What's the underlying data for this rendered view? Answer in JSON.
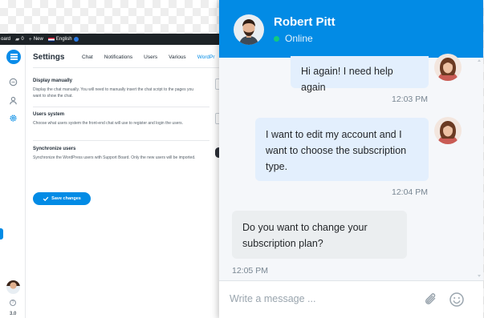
{
  "admin": {
    "wpbar": {
      "site_fragment": "oard",
      "comments_count": "0",
      "new_label": "New",
      "language_label": "English"
    },
    "rail_version": "3.0",
    "settings_title": "Settings",
    "tabs": [
      "Chat",
      "Notifications",
      "Users",
      "Various",
      "WordPr"
    ],
    "options": [
      {
        "title": "Display manually",
        "description": "Display the chat manually. You will need to manually insert the chat script to the pages you want to show the chat."
      },
      {
        "title": "Users system",
        "description": "Choose what users system the front-end chat will use to register and login the users."
      },
      {
        "title": "Synchronize users",
        "description": "Synchronize the WordPress users with Support Board. Only the new users will be imported."
      }
    ],
    "save_label": "Save changes"
  },
  "chat": {
    "agent_name": "Robert Pitt",
    "status": "Online",
    "messages": [
      {
        "text": "Hi again! I need help again",
        "time": "12:03 PM"
      },
      {
        "text": "I want to edit my account and I want to choose the subscription type.",
        "time": "12:04 PM"
      },
      {
        "text": "Do you want to change your subscription plan?",
        "time": "12:05 PM"
      }
    ],
    "composer_placeholder": "Write a message ..."
  },
  "colors": {
    "accent": "#028be5",
    "online": "#13ca7e",
    "sent_bubble": "#e3effd",
    "received_bubble": "#ebeef0"
  },
  "icons": [
    "conversations-icon",
    "users-icon",
    "settings-icon",
    "help-icon",
    "attachment-icon",
    "emoji-icon"
  ]
}
